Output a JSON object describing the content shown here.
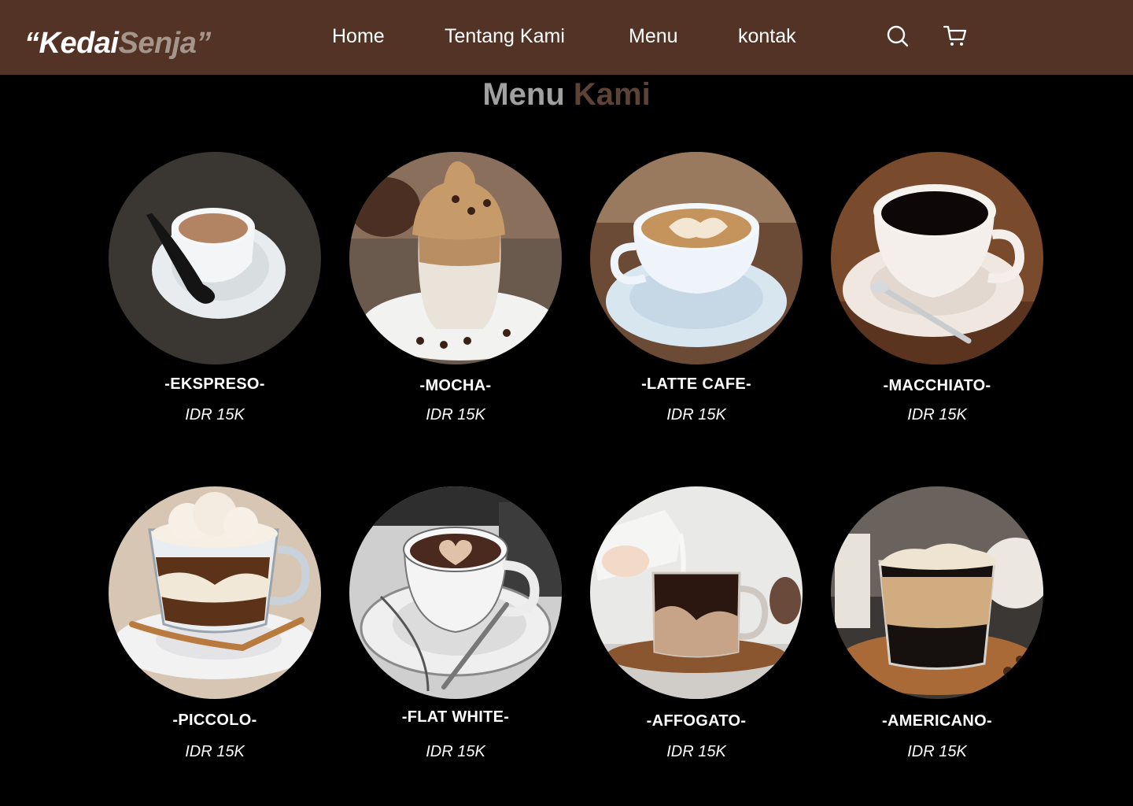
{
  "brand": {
    "part1": "“Kedai",
    "part2": "Senja”"
  },
  "nav": {
    "links": [
      "Home",
      "Tentang Kami",
      "Menu",
      "kontak"
    ],
    "icons": [
      "search-icon",
      "cart-icon"
    ]
  },
  "section": {
    "title_part1": "Menu",
    "title_part2": "Kami"
  },
  "menu": [
    {
      "name": "-EKSPRESO-",
      "price": "IDR 15K"
    },
    {
      "name": "-MOCHA-",
      "price": "IDR 15K"
    },
    {
      "name": "-LATTE CAFE-",
      "price": "IDR 15K"
    },
    {
      "name": "-MACCHIATO-",
      "price": "IDR 15K"
    },
    {
      "name": "-PICCOLO-",
      "price": "IDR 15K"
    },
    {
      "name": "-FLAT WHITE-",
      "price": "IDR 15K"
    },
    {
      "name": "-AFFOGATO-",
      "price": "IDR 15K"
    },
    {
      "name": "-AMERICANO-",
      "price": "IDR 15K"
    }
  ],
  "colors": {
    "navbar": "#533326",
    "background": "#000000",
    "accent": "#a5958b",
    "title_accent": "#5c4336"
  }
}
